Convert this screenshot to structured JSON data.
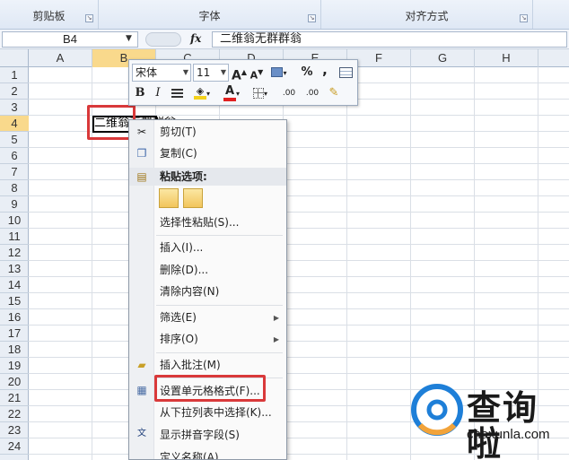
{
  "ribbon": {
    "groups": [
      {
        "label": "剪贴板"
      },
      {
        "label": "字体"
      },
      {
        "label": "对齐方式"
      }
    ]
  },
  "formula_bar": {
    "name_box": "B4",
    "fx_label": "fx",
    "content": "二维翁无群群翁"
  },
  "grid": {
    "columns": [
      "A",
      "B",
      "C",
      "D",
      "E",
      "F",
      "G",
      "H"
    ],
    "rows": [
      "1",
      "2",
      "3",
      "4",
      "5",
      "6",
      "7",
      "8",
      "9",
      "10",
      "11",
      "12",
      "13",
      "14",
      "15",
      "16",
      "17",
      "18",
      "19",
      "20",
      "21",
      "22",
      "23",
      "24"
    ],
    "selected_cell": {
      "ref": "B4",
      "text": "二维翁无群群翁"
    }
  },
  "mini_toolbar": {
    "font_name": "宋体",
    "font_size": "11",
    "grow_font": "A",
    "shrink_font": "A",
    "percent": "%",
    "comma": ",",
    "bold": "B",
    "italic": "I",
    "font_color_label": "A",
    "inc_decimal": ".00",
    "dec_decimal": ".00"
  },
  "context_menu": {
    "items": [
      {
        "label": "剪切(T)"
      },
      {
        "label": "复制(C)"
      },
      {
        "label": "粘贴选项:"
      },
      {
        "label": "选择性粘贴(S)..."
      },
      {
        "label": "插入(I)..."
      },
      {
        "label": "删除(D)..."
      },
      {
        "label": "清除内容(N)"
      },
      {
        "label": "筛选(E)"
      },
      {
        "label": "排序(O)"
      },
      {
        "label": "插入批注(M)"
      },
      {
        "label": "设置单元格格式(F)..."
      },
      {
        "label": "从下拉列表中选择(K)..."
      },
      {
        "label": "显示拼音字段(S)"
      },
      {
        "label": "定义名称(A)..."
      }
    ]
  },
  "watermark": {
    "title": "查询啦",
    "url": "chaxunla.com"
  },
  "colors": {
    "annotation": "#d9393a",
    "selected_header": "#f9d98c",
    "ribbon_bg": "#dfe8f5"
  }
}
